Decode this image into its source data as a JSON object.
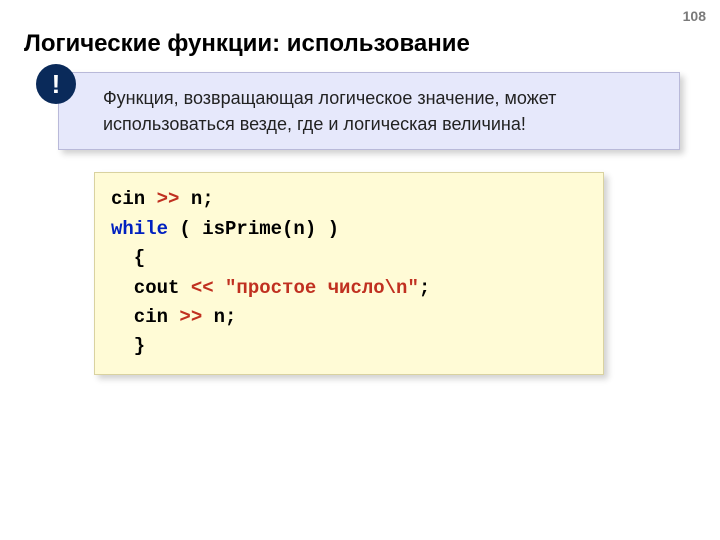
{
  "page_number": "108",
  "title": "Логические функции: использование",
  "callout": {
    "bang": "!",
    "text": "Функция, возвращающая логическое значение, может использоваться везде, где и логическая величина!"
  },
  "code": {
    "l1a": "cin ",
    "l1b": ">>",
    "l1c": " n;",
    "l2a": "while",
    "l2b": " ( isPrime(n) )",
    "l3": "  {",
    "l4a": "  cout ",
    "l4b": "<< \"простое число\\n\"",
    "l4c": ";",
    "l5a": "  cin ",
    "l5b": ">>",
    "l5c": " n;",
    "l6": "  }"
  }
}
